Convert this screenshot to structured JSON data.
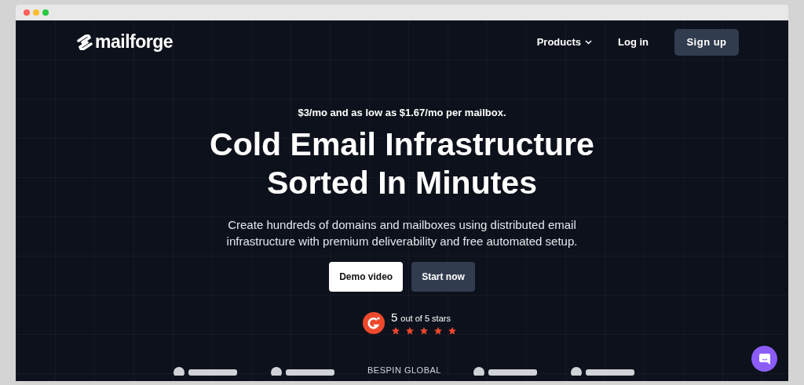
{
  "nav": {
    "logo": "mailforge",
    "items": [
      {
        "label": "Products",
        "kind": "dropdown"
      },
      {
        "label": "Log in",
        "kind": "link"
      }
    ],
    "cta": "Sign up"
  },
  "hero": {
    "pricing": "$3/mo and as low as $1.67/mo per mailbox.",
    "title": [
      "Cold Email Infrastructure",
      "Sorted In Minutes"
    ],
    "subtitle": "Create hundreds of domains and mailboxes using distributed email infrastructure with premium deliverability and free automated setup.",
    "buttons": [
      {
        "label": "Demo video",
        "kind": "light"
      },
      {
        "label": "Start now",
        "kind": "dark"
      }
    ]
  },
  "rating": {
    "score": "5",
    "caption": "out of 5 stars",
    "stars": 5
  },
  "logos": [
    {
      "kind": "shape"
    },
    {
      "kind": "shape"
    },
    {
      "kind": "text",
      "label": "BESPIN GLOBAL"
    },
    {
      "kind": "shape"
    },
    {
      "kind": "shape"
    }
  ]
}
